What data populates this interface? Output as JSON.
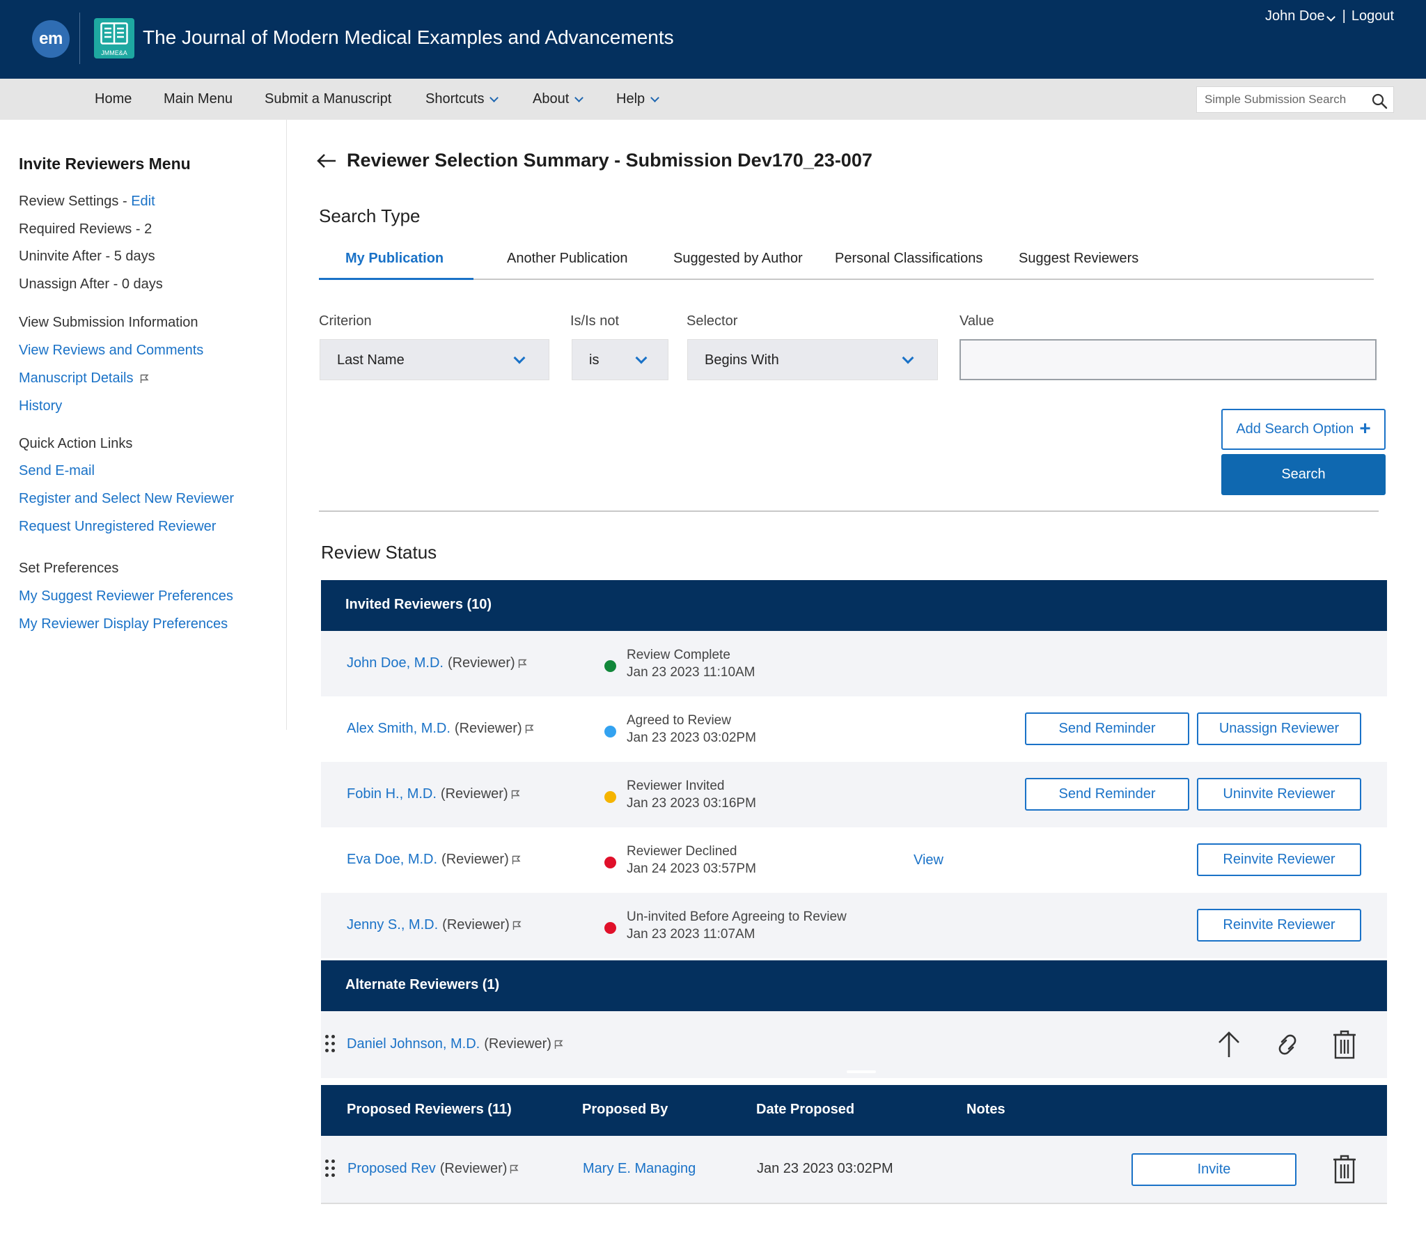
{
  "header": {
    "logo_text": "em",
    "journal_abbr": "JMME&A",
    "journal_title": "The Journal of Modern Medical Examples and Advancements",
    "user_name": "John Doe",
    "separator": "|",
    "logout_label": "Logout"
  },
  "nav": {
    "items": [
      "Home",
      "Main Menu",
      "Submit a Manuscript",
      "Shortcuts",
      "About",
      "Help"
    ],
    "search_placeholder": "Simple Submission Search"
  },
  "sidebar": {
    "title": "Invite Reviewers Menu",
    "review_settings_label": "Review Settings -",
    "review_settings_link": "Edit",
    "required_reviews_label": "Required Reviews -",
    "required_reviews_value": "2",
    "uninvite_after_label": "Uninvite After -",
    "uninvite_after_value": "5 days",
    "unassign_after_label": "Unassign After -",
    "unassign_after_value": "0 days",
    "view_submission_heading": "View Submission Information",
    "view_reviews_link": "View Reviews and Comments",
    "manuscript_details_link": "Manuscript Details",
    "history_link": "History",
    "quick_action_heading": "Quick Action Links",
    "send_email_link": "Send E-mail",
    "register_link": "Register and Select New Reviewer",
    "request_unregistered_link": "Request Unregistered Reviewer",
    "set_preferences_heading": "Set Preferences",
    "suggest_prefs_link": "My Suggest Reviewer Preferences",
    "display_prefs_link": "My Reviewer Display Preferences"
  },
  "main": {
    "title": "Reviewer Selection Summary - Submission Dev170_23-007",
    "search_type_heading": "Search Type",
    "tabs": [
      "My Publication",
      "Another Publication",
      "Suggested by Author",
      "Personal Classifications",
      "Suggest Reviewers"
    ],
    "active_tab": "My Publication",
    "criterion_label": "Criterion",
    "criterion_value": "Last Name",
    "isnot_label": "Is/Is not",
    "isnot_value": "is",
    "selector_label": "Selector",
    "selector_value": "Begins With",
    "value_label": "Value",
    "value_input": "",
    "add_search_option_label": "Add Search Option",
    "add_icon": "+",
    "search_button_label": "Search",
    "review_status_heading": "Review Status"
  },
  "invited": {
    "heading": "Invited Reviewers (10)",
    "rows": [
      {
        "name": "John Doe, M.D.",
        "role": "(Reviewer)",
        "status": "Review Complete",
        "date": "Jan 23 2023 11:10AM",
        "dot_color": "#11873a",
        "view": "",
        "btn1": "",
        "btn2": ""
      },
      {
        "name": "Alex Smith, M.D.",
        "role": "(Reviewer)",
        "status": "Agreed to Review",
        "date": "Jan 23 2023 03:02PM",
        "dot_color": "#33a2f0",
        "view": "",
        "btn1": "Send Reminder",
        "btn2": "Unassign Reviewer"
      },
      {
        "name": "Fobin H., M.D.",
        "role": "(Reviewer)",
        "status": "Reviewer Invited",
        "date": "Jan 23 2023 03:16PM",
        "dot_color": "#f5b400",
        "view": "",
        "btn1": "Send Reminder",
        "btn2": "Uninvite Reviewer"
      },
      {
        "name": "Eva Doe, M.D.",
        "role": "(Reviewer)",
        "status": "Reviewer Declined",
        "date": "Jan 24 2023 03:57PM",
        "dot_color": "#e0102a",
        "view": "View",
        "btn1": "",
        "btn2": "Reinvite Reviewer"
      },
      {
        "name": "Jenny S., M.D.",
        "role": "(Reviewer)",
        "status": "Un-invited Before Agreeing to Review",
        "date": "Jan 23 2023 11:07AM",
        "dot_color": "#e0102a",
        "view": "",
        "btn1": "",
        "btn2": "Reinvite Reviewer"
      }
    ]
  },
  "alternate": {
    "heading": "Alternate Reviewers (1)",
    "name": "Daniel Johnson, M.D.",
    "role": "(Reviewer)"
  },
  "proposed": {
    "heading": "Proposed Reviewers (11)",
    "col_proposed_by": "Proposed By",
    "col_date": "Date Proposed",
    "col_notes": "Notes",
    "name": "Proposed Rev",
    "role": "(Reviewer)",
    "proposed_by": "Mary E. Managing",
    "date": "Jan 23 2023 03:02PM",
    "invite_label": "Invite"
  },
  "icons": [
    "search-icon",
    "back-arrow-icon",
    "flag-icon",
    "chevron-down-icon",
    "drag-handle-icon",
    "move-up-arrow-icon",
    "link-icon",
    "trash-icon",
    "journal-book-icon"
  ],
  "colors": {
    "header_bg": "#04305e",
    "link": "#1a72c7",
    "primary_button": "#0f68b0",
    "nav_bg": "#e5e5e5"
  }
}
